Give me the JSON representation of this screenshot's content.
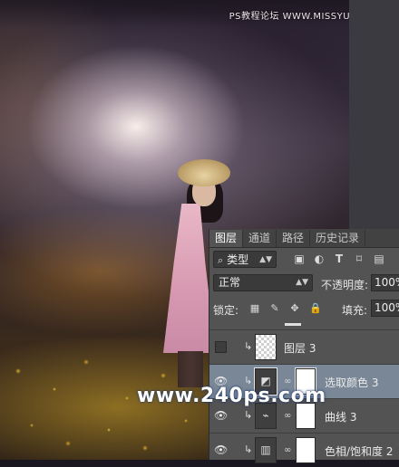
{
  "watermark_top": "PS教程论坛 WWW.MISSYUAN.COM",
  "watermark_center": "www.240ps.com",
  "panel": {
    "tabs": [
      "图层",
      "通道",
      "路径",
      "历史记录"
    ],
    "filter": {
      "search_glyph": "⌕",
      "kind": "类型"
    },
    "filter_icons": [
      "image-filter-icon",
      "adjustment-filter-icon",
      "type-filter-icon",
      "shape-filter-icon",
      "smart-object-filter-icon"
    ],
    "blend_mode": "正常",
    "opacity_label": "不透明度:",
    "opacity_value": "100%",
    "lock_label": "锁定:",
    "fill_label": "填充:",
    "fill_value": "100%",
    "layers": [
      {
        "name": "图层 3",
        "visible": false,
        "thumb": "checker",
        "selected": false
      },
      {
        "name": "选取颜色 3",
        "visible": true,
        "thumb": "selective-color",
        "selected": true
      },
      {
        "name": "曲线 3",
        "visible": true,
        "thumb": "curves",
        "selected": false
      },
      {
        "name": "色相/饱和度 2",
        "visible": true,
        "thumb": "hue-saturation",
        "selected": false
      }
    ]
  },
  "colors": {
    "panel_bg": "#535353",
    "tab_bar": "#424242",
    "selected_layer": "#7a8797",
    "watermark_glow": "#1a3a7a"
  }
}
